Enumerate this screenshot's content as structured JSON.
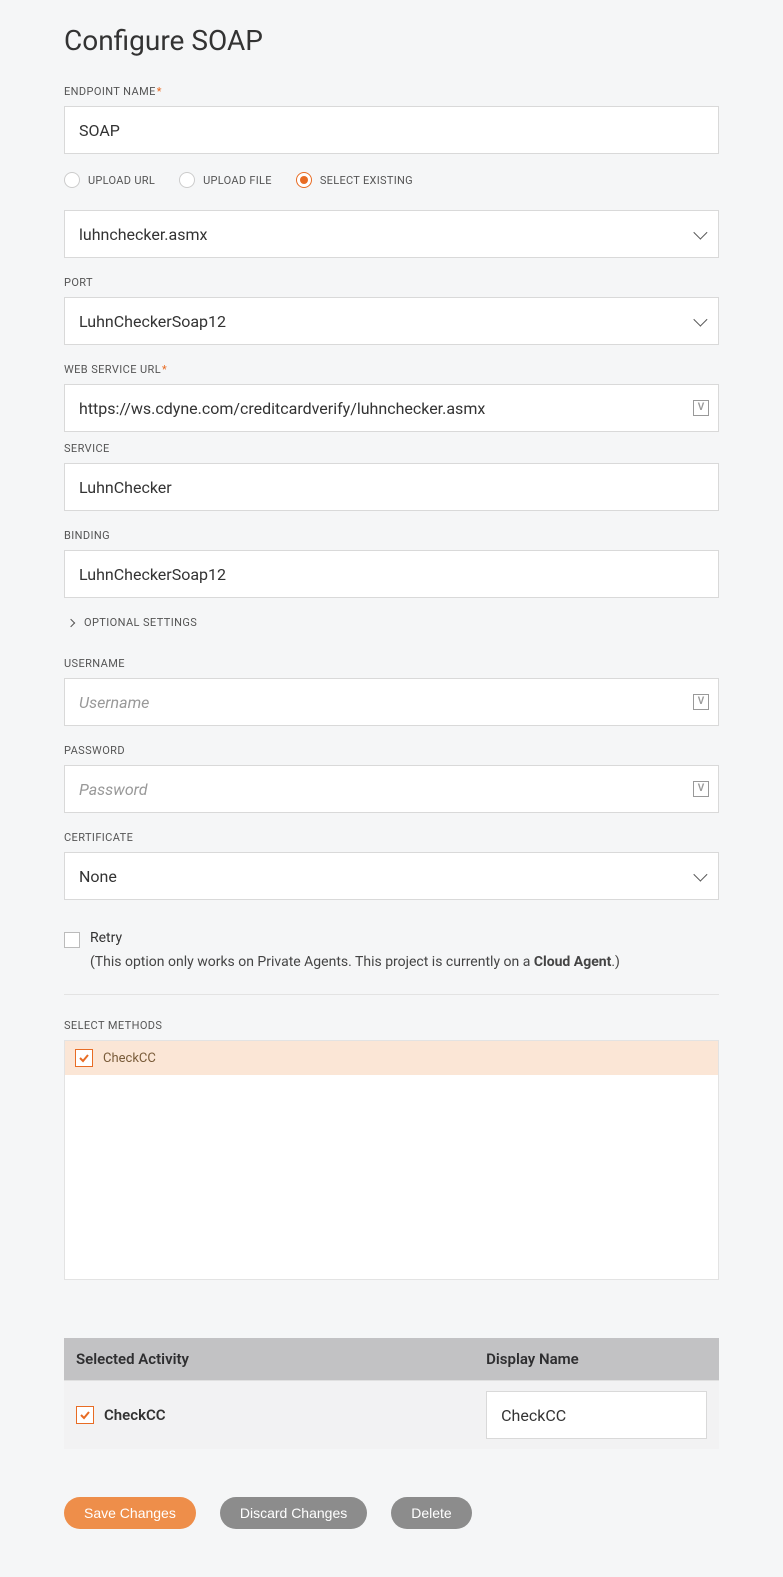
{
  "title": "Configure SOAP",
  "labels": {
    "endpoint_name": "ENDPOINT NAME",
    "port": "PORT",
    "web_service_url": "WEB SERVICE URL",
    "service": "SERVICE",
    "binding": "BINDING",
    "optional_settings": "OPTIONAL SETTINGS",
    "username": "USERNAME",
    "password": "PASSWORD",
    "certificate": "CERTIFICATE",
    "select_methods": "SELECT METHODS",
    "retry": "Retry",
    "selected_activity": "Selected Activity",
    "display_name": "Display Name"
  },
  "placeholders": {
    "username": "Username",
    "password": "Password"
  },
  "values": {
    "endpoint_name": "SOAP",
    "wsdl_selected": "luhnchecker.asmx",
    "port": "LuhnCheckerSoap12",
    "web_service_url": "https://ws.cdyne.com/creditcardverify/luhnchecker.asmx",
    "service": "LuhnChecker",
    "binding": "LuhnCheckerSoap12",
    "username": "",
    "password": "",
    "certificate": "None"
  },
  "source_options": {
    "upload_url": "UPLOAD URL",
    "upload_file": "UPLOAD FILE",
    "select_existing": "SELECT EXISTING",
    "selected": "select_existing"
  },
  "retry_note": {
    "prefix": "(This option only works on Private Agents. This project is currently on a ",
    "bold": "Cloud Agent",
    "suffix": ".)"
  },
  "methods": [
    {
      "name": "CheckCC",
      "checked": true,
      "selected": true
    }
  ],
  "selected_activities": [
    {
      "name": "CheckCC",
      "display": "CheckCC",
      "checked": true
    }
  ],
  "buttons": {
    "save": "Save Changes",
    "discard": "Discard Changes",
    "delete": "Delete"
  },
  "var_badge": "V"
}
